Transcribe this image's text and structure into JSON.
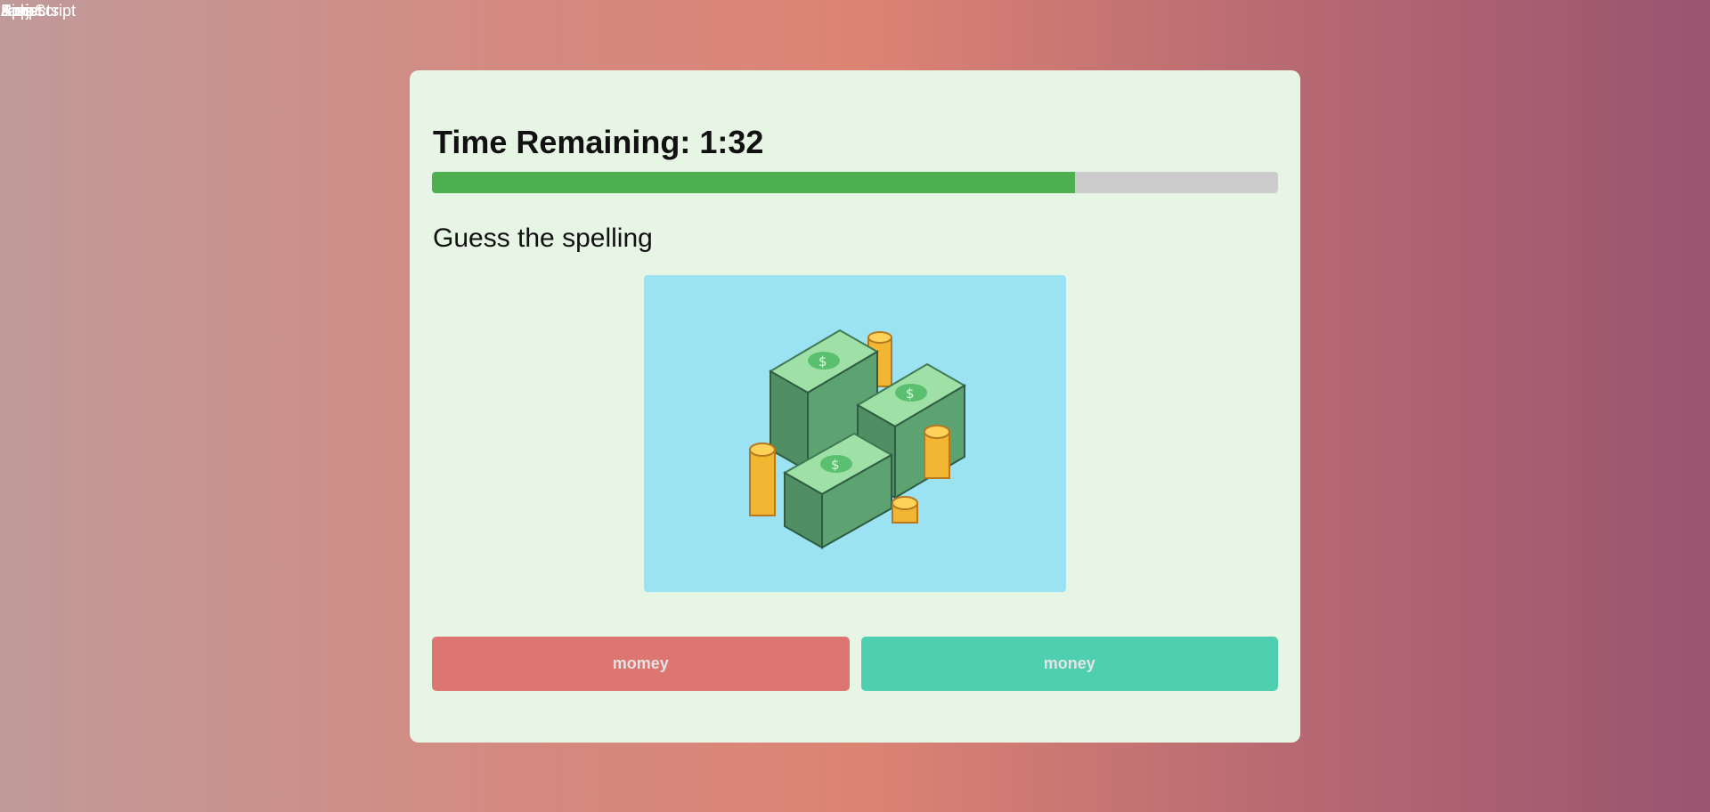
{
  "top_overlap": [
    "JavaScript",
    "Apps",
    "Script",
    "Projects",
    "Kids"
  ],
  "timer": {
    "label": "Time Remaining: 1:32",
    "progress": 0.76
  },
  "colors": {
    "progress_fill": "#4caf50",
    "progress_track": "#cccccc",
    "wrong": "#dd7570",
    "right": "#4ecfb0",
    "card": "#e7f5e5",
    "image_bg": "#9be3f2"
  },
  "question": {
    "prompt": "Guess the spelling",
    "image_icon": "money-stack-illustration"
  },
  "answers": [
    {
      "label": "momey",
      "color": "#dd7570"
    },
    {
      "label": "money",
      "color": "#4ecfb0"
    }
  ]
}
